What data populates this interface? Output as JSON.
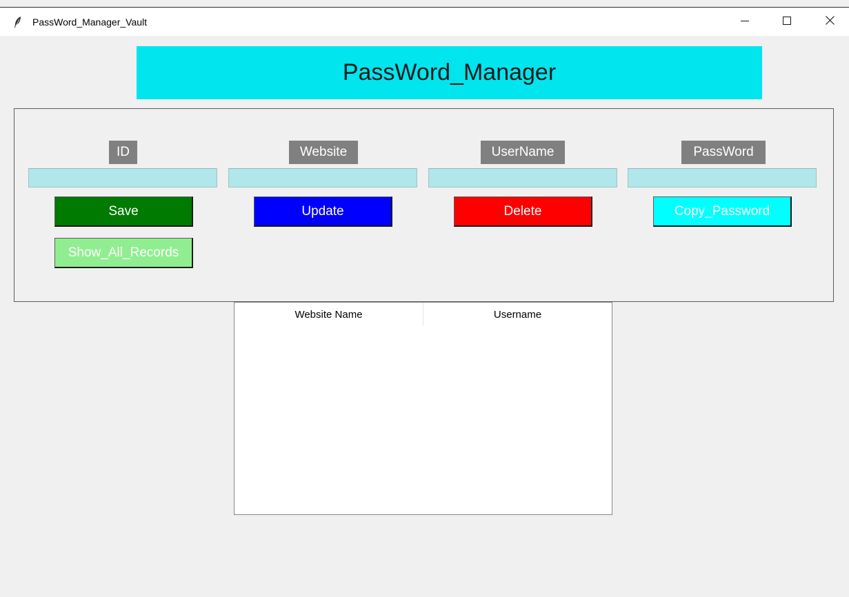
{
  "window": {
    "title": "PassWord_Manager_Vault",
    "icon": "feather-icon",
    "controls": {
      "minimize": "minimize-icon",
      "maximize": "maximize-icon",
      "close": "close-icon"
    }
  },
  "header": {
    "title": "PassWord_Manager",
    "background": "#00e5ee"
  },
  "form": {
    "fields": [
      {
        "label": "ID",
        "value": ""
      },
      {
        "label": "Website",
        "value": ""
      },
      {
        "label": "UserName",
        "value": ""
      },
      {
        "label": "PassWord",
        "value": ""
      }
    ],
    "buttons": {
      "save": {
        "label": "Save",
        "color": "#007a00"
      },
      "update": {
        "label": "Update",
        "color": "#0000ff"
      },
      "delete": {
        "label": "Delete",
        "color": "#ff0000"
      },
      "copy_password": {
        "label": "Copy_Password",
        "color": "#00ffff"
      },
      "show_all_records": {
        "label": "Show_All_Records",
        "color": "#90ee90"
      }
    }
  },
  "records_table": {
    "columns": [
      "Website Name",
      "Username"
    ],
    "rows": []
  }
}
